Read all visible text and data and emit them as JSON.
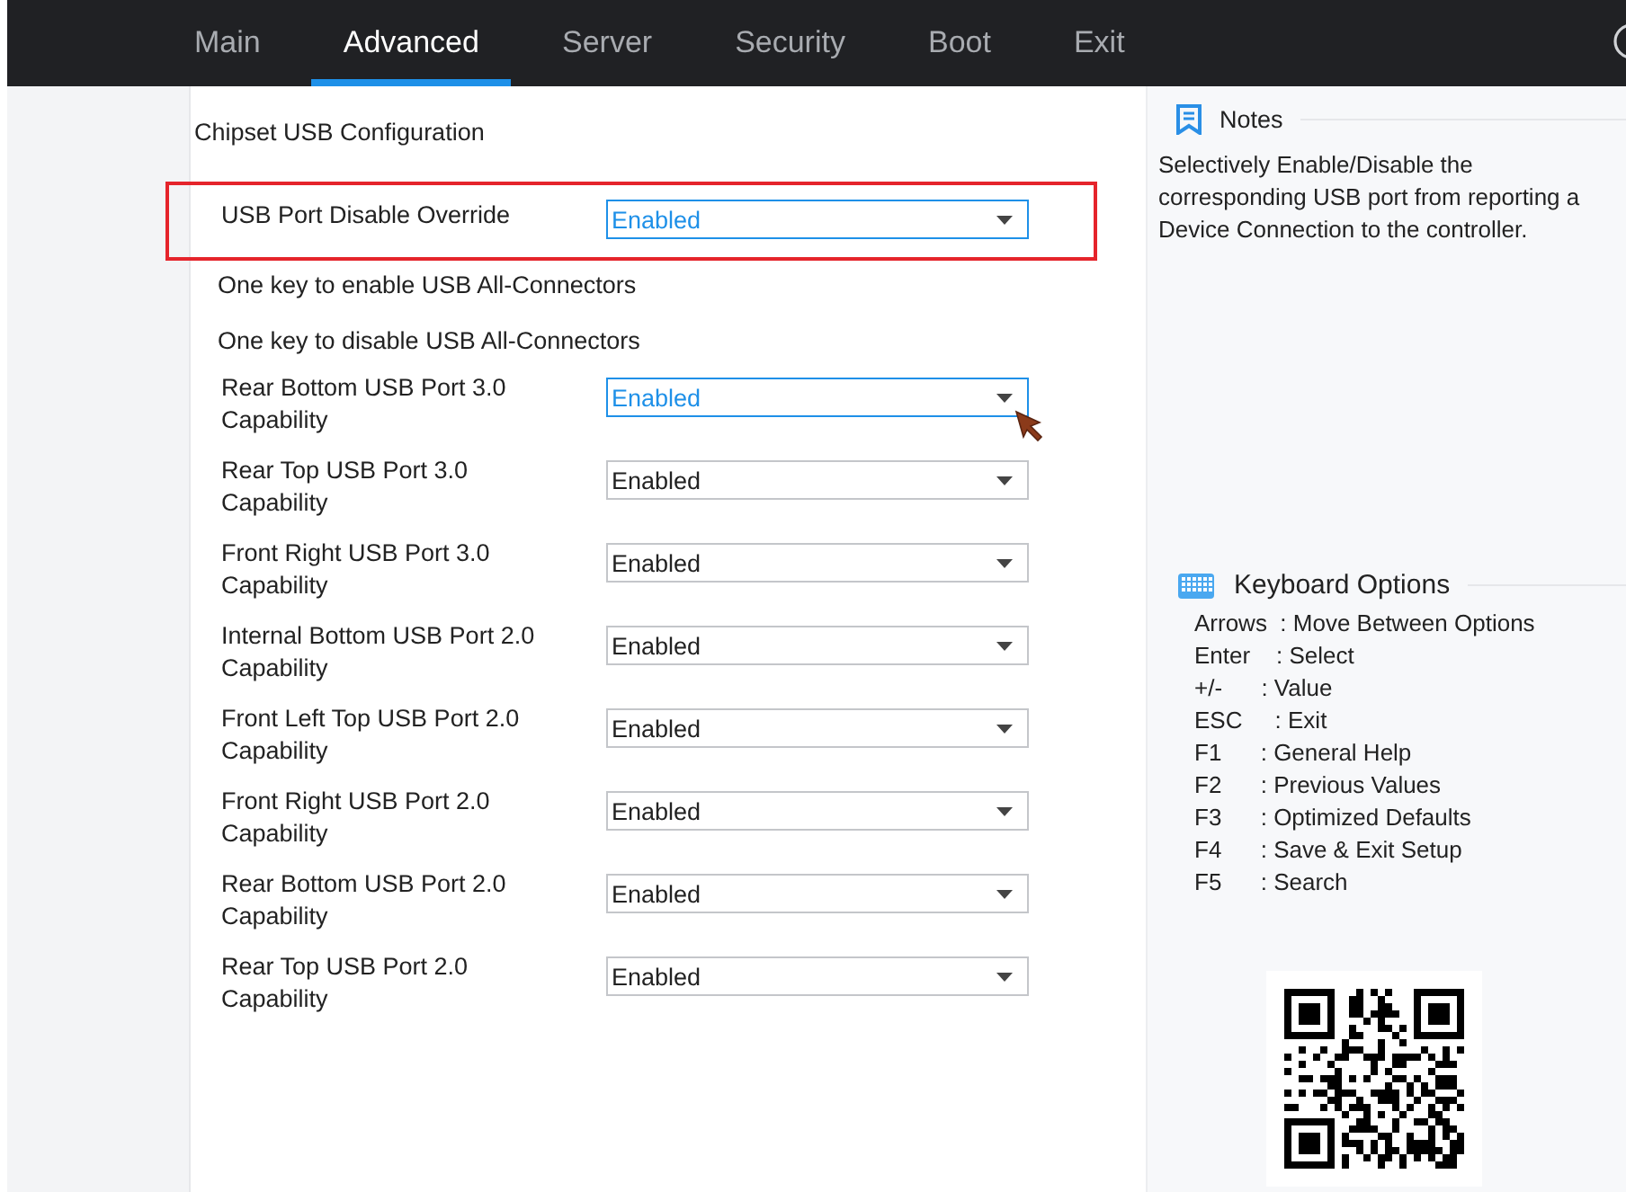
{
  "tabs": [
    {
      "label": "Main",
      "selected": false
    },
    {
      "label": "Advanced",
      "selected": true
    },
    {
      "label": "Server",
      "selected": false
    },
    {
      "label": "Security",
      "selected": false
    },
    {
      "label": "Boot",
      "selected": false
    },
    {
      "label": "Exit",
      "selected": false
    }
  ],
  "settings": [
    {
      "kind": "heading",
      "label": "Chipset USB Configuration"
    },
    {
      "kind": "select",
      "label": "USB Port Disable Override",
      "value": "Enabled",
      "selected": true,
      "focused": true
    },
    {
      "kind": "action",
      "label": "One key to enable USB All-Connectors"
    },
    {
      "kind": "action",
      "label": "One key to disable USB All-Connectors"
    },
    {
      "kind": "select",
      "label": "Rear Bottom USB Port 3.0 Capability",
      "value": "Enabled",
      "selected": false,
      "focused": true
    },
    {
      "kind": "select",
      "label": "Rear Top USB Port 3.0 Capability",
      "value": "Enabled",
      "selected": false,
      "focused": false
    },
    {
      "kind": "select",
      "label": "Front Right USB Port 3.0 Capability",
      "value": "Enabled",
      "selected": false,
      "focused": false
    },
    {
      "kind": "select",
      "label": "Internal Bottom USB Port 2.0 Capability",
      "value": "Enabled",
      "selected": false,
      "focused": false
    },
    {
      "kind": "select",
      "label": "Front Left Top USB Port 2.0 Capability",
      "value": "Enabled",
      "selected": false,
      "focused": false
    },
    {
      "kind": "select",
      "label": "Front Right USB Port 2.0 Capability",
      "value": "Enabled",
      "selected": false,
      "focused": false
    },
    {
      "kind": "select",
      "label": "Rear Bottom USB Port 2.0 Capability",
      "value": "Enabled",
      "selected": false,
      "focused": false
    },
    {
      "kind": "select",
      "label": "Rear Top USB Port 2.0 Capability",
      "value": "Enabled",
      "selected": false,
      "focused": false
    }
  ],
  "notes": {
    "title": "Notes",
    "text": "Selectively Enable/Disable the corresponding USB port from reporting a Device Connection to the controller."
  },
  "keyboard_options": {
    "title": "Keyboard Options",
    "lines": [
      "Arrows  : Move Between Options",
      "Enter    : Select",
      "+/-      : Value",
      "ESC     : Exit",
      "F1      : General Help",
      "F2      : Previous Values",
      "F3      : Optimized Defaults",
      "F4      : Save & Exit Setup",
      "F5      : Search"
    ]
  }
}
